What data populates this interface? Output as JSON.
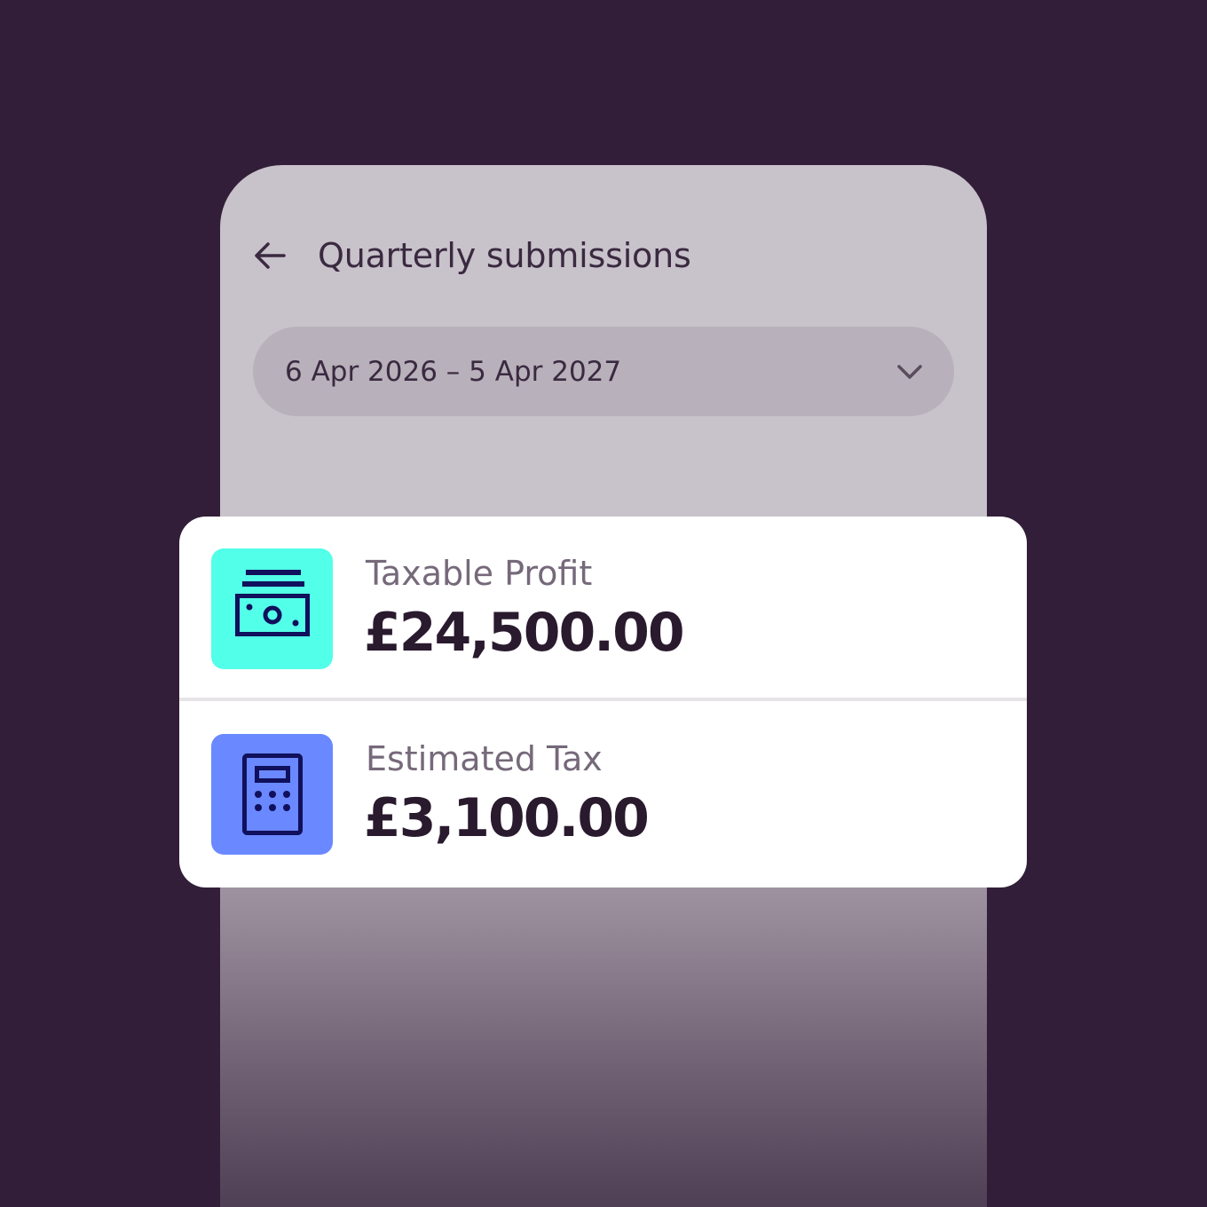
{
  "screen": {
    "title": "Quarterly submissions",
    "back_icon": "arrow-left-icon"
  },
  "period_selector": {
    "value": "6 Apr 2026 – 5 Apr 2027",
    "icon": "chevron-down-icon"
  },
  "summary": [
    {
      "label": "Taxable Profit",
      "amount": "£24,500.00",
      "icon": "banknotes-icon",
      "tile_color": "#52ffe8"
    },
    {
      "label": "Estimated Tax",
      "amount": "£3,100.00",
      "icon": "calculator-icon",
      "tile_color": "#6a88ff"
    }
  ],
  "colors": {
    "background": "#321e38",
    "icon_stroke": "#10105c"
  }
}
